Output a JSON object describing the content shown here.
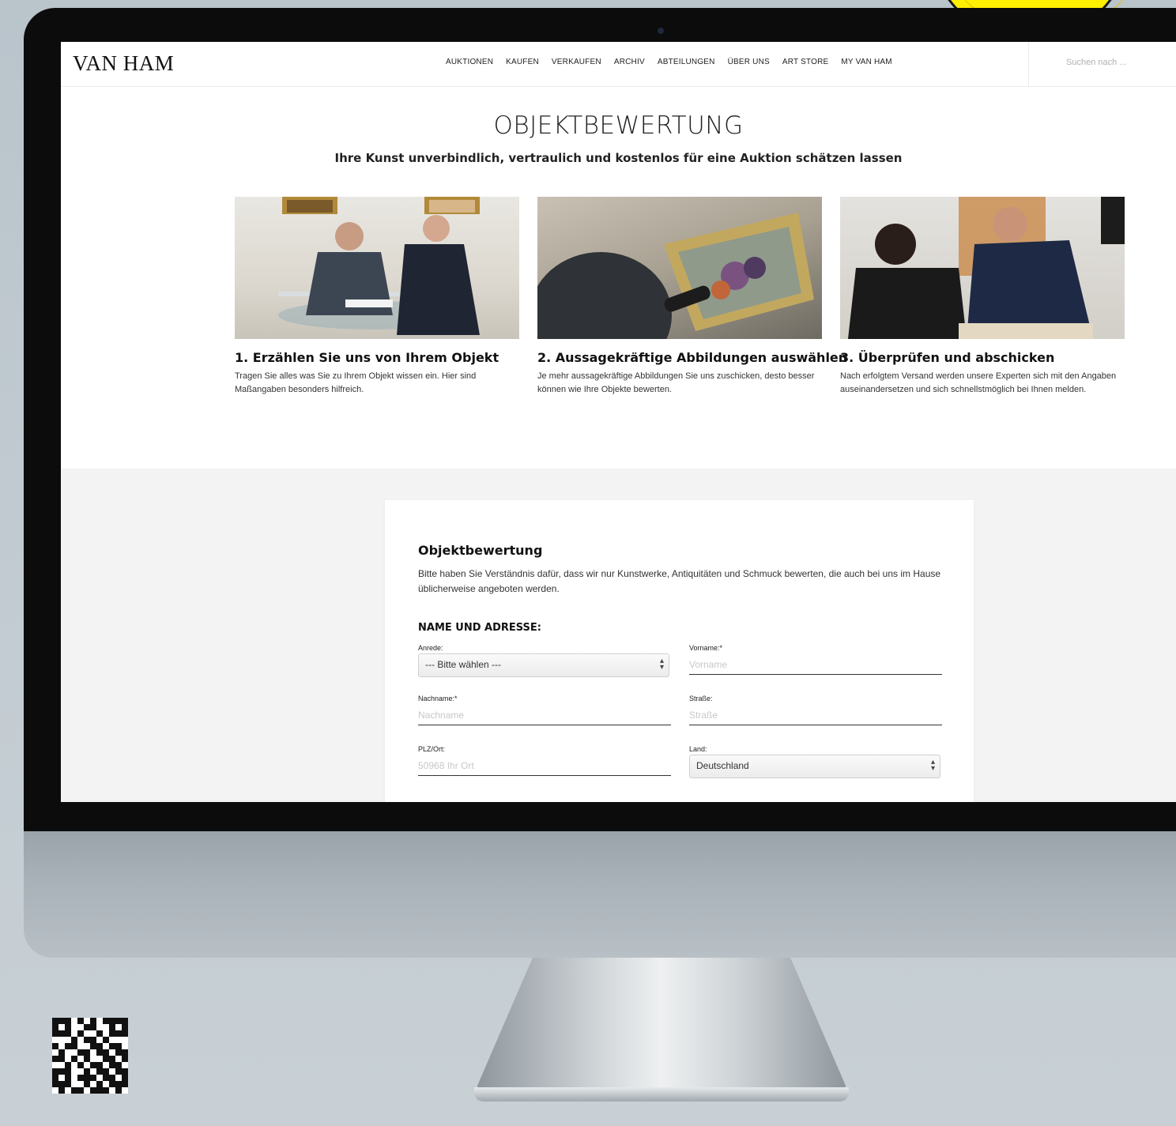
{
  "header": {
    "logo": "VAN HAM",
    "nav": [
      "AUKTIONEN",
      "KAUFEN",
      "VERKAUFEN",
      "ARCHIV",
      "ABTEILUNGEN",
      "ÜBER UNS",
      "ART STORE",
      "MY VAN HAM"
    ],
    "search_placeholder": "Suchen nach ..."
  },
  "hero": {
    "title": "OBJEKTBEWERTUNG",
    "subtitle": "Ihre Kunst unverbindlich, vertraulich und kostenlos für eine Auktion schätzen lassen"
  },
  "steps": [
    {
      "title": "1. Erzählen Sie uns von Ihrem Objekt",
      "text": "Tragen Sie alles was Sie zu Ihrem Objekt wissen ein. Hier sind Maßangaben besonders hilfreich."
    },
    {
      "title": "2. Aussagekräftige Abbildungen auswählen",
      "text": "Je mehr aussagekräftige Abbildungen Sie uns zuschicken, desto besser können wie Ihre Objekte bewerten."
    },
    {
      "title": "3. Überprüfen und abschicken",
      "text": "Nach erfolgtem Versand werden unsere Experten sich mit den Angaben auseinandersetzen und sich schnellstmöglich bei Ihnen melden."
    }
  ],
  "form": {
    "title": "Objektbewertung",
    "intro": "Bitte haben Sie Verständnis dafür, dass wir nur Kunstwerke, Antiquitäten und Schmuck bewerten, die auch bei uns im Hause üblicherweise angeboten werden.",
    "section": "NAME UND ADRESSE:",
    "anrede": {
      "label": "Anrede:",
      "value": "--- Bitte wählen ---"
    },
    "vorname": {
      "label": "Vorname:*",
      "placeholder": "Vorname"
    },
    "nachname": {
      "label": "Nachname:*",
      "placeholder": "Nachname"
    },
    "strasse": {
      "label": "Straße:",
      "placeholder": "Straße"
    },
    "plzort": {
      "label": "PLZ/Ort:",
      "placeholder": "50968 Ihr Ort"
    },
    "land": {
      "label": "Land:",
      "value": "Deutschland"
    }
  },
  "colors": {
    "sticker": "#ffef00",
    "bezel": "#0c0c0c",
    "form_background": "#f3f3f3"
  }
}
